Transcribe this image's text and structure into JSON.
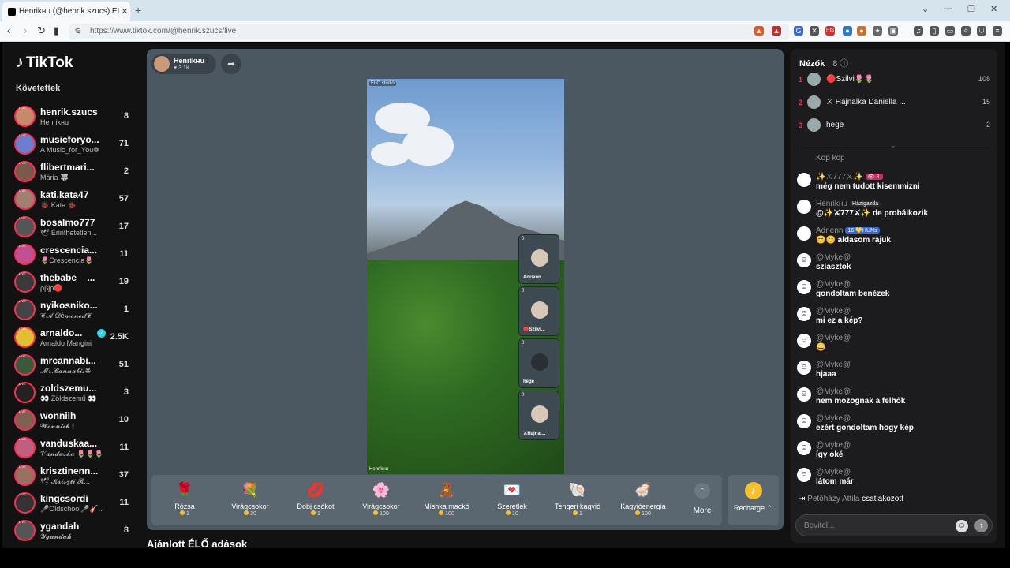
{
  "browser": {
    "tab_title": "Henrikнu (@henrik.szucs) ÉLŐ",
    "url": "https://www.tiktok.com/@henrik.szucs/live",
    "new_tab": "+",
    "close_tab": "✕"
  },
  "sidebar": {
    "logo": "TikTok",
    "followed_heading": "Követettek",
    "accounts": [
      {
        "name": "henrik.szucs",
        "sub": "Henrikнu",
        "count": "8",
        "color": "#c58a6a"
      },
      {
        "name": "musicforyo...",
        "sub": "A Music_for_You❁",
        "count": "71",
        "color": "#6a7fd0"
      },
      {
        "name": "flibertmari...",
        "sub": "Mária 🐺",
        "count": "2",
        "color": "#7a5a4a"
      },
      {
        "name": "kati.kata47",
        "sub": "🐞 Kata 🐞",
        "count": "57",
        "color": "#a08070"
      },
      {
        "name": "bosalmo777",
        "sub": "🕊 Érinthetetlen...",
        "count": "17",
        "color": "#555"
      },
      {
        "name": "crescencia...",
        "sub": "🌷Crescencia🌷",
        "count": "11",
        "color": "#c05090"
      },
      {
        "name": "thebabe__...",
        "sub": "ρβjρ🔴",
        "count": "19",
        "color": "#3a3a3a"
      },
      {
        "name": "nyikosniko...",
        "sub": "❦𝓐 𝓓é𝓶𝓸𝓷𝓸𝓭❦",
        "count": "1",
        "color": "#444"
      },
      {
        "name": "arnaldo...",
        "sub": "Arnaldo Mangini",
        "count": "2.5K",
        "color": "#e0c030",
        "verified": true
      },
      {
        "name": "mrcannabi...",
        "sub": "𝓜𝓻.𝓒𝓪𝓷𝓷𝓪𝓫𝓲𝓼❁",
        "count": "51",
        "color": "#3a5a3a"
      },
      {
        "name": "zoldszemu...",
        "sub": "👀 Zöldszemű 👀",
        "count": "3",
        "color": "#222"
      },
      {
        "name": "wonniih",
        "sub": "𝓦𝓸𝓷𝓷𝓲𝓲𝓱 🕯",
        "count": "10",
        "color": "#806050"
      },
      {
        "name": "vanduskaa...",
        "sub": "𝓥𝓪𝓷𝓭𝓾𝓼𝓴𝓪 🌷🌷🌷...",
        "count": "11",
        "color": "#c06080"
      },
      {
        "name": "krisztinenn...",
        "sub": "🕊 𝓚𝓻𝓲𝓼𝔃𝓽𝓲 𝓡...",
        "count": "37",
        "color": "#9a7060"
      },
      {
        "name": "kingcsordi",
        "sub": "🎤Oldschool🎤🎸...",
        "count": "11",
        "color": "#333"
      },
      {
        "name": "ygandah",
        "sub": "𝓨𝓰𝓪𝓷𝓭𝓪𝓱",
        "count": "8",
        "color": "#555"
      }
    ]
  },
  "stream": {
    "host_name": "Henrikнu",
    "host_likes": "♥ 3.1K",
    "live_tag": "ÉLŐ stúdió",
    "watermark": "Henrikнu",
    "guests": [
      {
        "count": "0",
        "name": "Adrienn"
      },
      {
        "count": "0",
        "name": "🔴Szilvi..."
      },
      {
        "count": "0",
        "name": "hege"
      },
      {
        "count": "0",
        "name": "⚔Hajnal..."
      }
    ]
  },
  "gifts": [
    {
      "name": "Rózsa",
      "price": "1",
      "emoji": "🌹"
    },
    {
      "name": "Virágcsokor",
      "price": "30",
      "emoji": "💐"
    },
    {
      "name": "Dobj csókot",
      "price": "1",
      "emoji": "💋"
    },
    {
      "name": "Virágcsokor",
      "price": "100",
      "emoji": "🌸"
    },
    {
      "name": "Mishka mackó",
      "price": "100",
      "emoji": "🧸"
    },
    {
      "name": "Szeretlek",
      "price": "10",
      "emoji": "💌"
    },
    {
      "name": "Tengeri kagyió",
      "price": "1",
      "emoji": "🐚"
    },
    {
      "name": "Kagyióenergia",
      "price": "100",
      "emoji": "🦪"
    }
  ],
  "more_label": "More",
  "recharge_label": "Recharge",
  "recommended_heading": "Ajánlott ÉLŐ adások",
  "viewers": {
    "heading": "Nézők",
    "count": "· 8",
    "top": [
      {
        "rank": "1",
        "name": "🔴Szilvi🌷🌷",
        "score": "108"
      },
      {
        "rank": "2",
        "name": "⚔ Hajnalka Daniella ...",
        "score": "15"
      },
      {
        "rank": "3",
        "name": "hege",
        "score": "2"
      }
    ]
  },
  "chat": [
    {
      "user": "Kop kop",
      "text": ""
    },
    {
      "user": "✨⚔777⚔✨",
      "badge": "👁 3.",
      "text": "még nem tudott kisemmizni"
    },
    {
      "user": "Henrikнu",
      "badge": "Házigazda",
      "text": "@✨⚔777⚔✨ de probálkozik"
    },
    {
      "user": "Adrienn",
      "badge": "16 💛HUNs",
      "text": "😊😊 aldasom rajuk"
    },
    {
      "user": "@Myke@",
      "text": "sziasztok"
    },
    {
      "user": "@Myke@",
      "text": "gondoltam benézek"
    },
    {
      "user": "@Myke@",
      "text": "mi ez a kép?"
    },
    {
      "user": "@Myke@",
      "text": "😄"
    },
    {
      "user": "@Myke@",
      "text": "hjaaa"
    },
    {
      "user": "@Myke@",
      "text": "nem mozognak a felhők"
    },
    {
      "user": "@Myke@",
      "text": "ezért gondoltam hogy kép"
    },
    {
      "user": "@Myke@",
      "text": "így oké"
    },
    {
      "user": "@Myke@",
      "text": "látom már"
    }
  ],
  "joined": {
    "user": "Petőházy Attila",
    "text": "csatlakozott"
  },
  "input_placeholder": "Bevitel..."
}
